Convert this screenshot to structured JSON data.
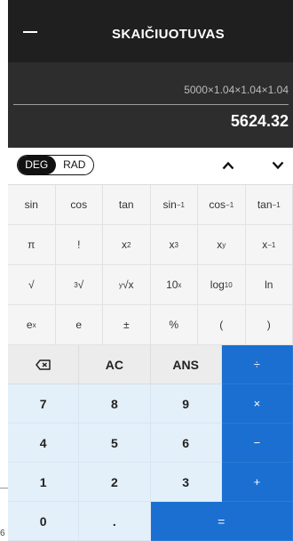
{
  "header": {
    "title": "SKAIČIUOTUVAS"
  },
  "display": {
    "expression": "5000×1.04×1.04×1.04",
    "result": "5624.32"
  },
  "mode": {
    "deg_label": "DEG",
    "rad_label": "RAD",
    "active": "DEG"
  },
  "scientific_keys": [
    [
      {
        "text": "sin"
      },
      {
        "text": "cos"
      },
      {
        "text": "tan"
      },
      {
        "text": "sin",
        "sup": "−1"
      },
      {
        "text": "cos",
        "sup": "−1"
      },
      {
        "text": "tan",
        "sup": "−1"
      }
    ],
    [
      {
        "text": "π"
      },
      {
        "text": "!"
      },
      {
        "text": "x",
        "sup": "2"
      },
      {
        "text": "x",
        "sup": "3"
      },
      {
        "text": "x",
        "sup": "y"
      },
      {
        "text": "x",
        "sup": "−1"
      }
    ],
    [
      {
        "text": "√"
      },
      {
        "pre": "3",
        "text": "√"
      },
      {
        "pre": "y",
        "text": "√x"
      },
      {
        "text": "10",
        "sup": "x"
      },
      {
        "text": "log",
        "sub": "10"
      },
      {
        "text": "ln"
      }
    ],
    [
      {
        "text": "e",
        "sup": "x"
      },
      {
        "text": "e"
      },
      {
        "text": "±"
      },
      {
        "text": "%"
      },
      {
        "text": "("
      },
      {
        "text": ")"
      }
    ]
  ],
  "main_keys": {
    "backspace_icon": "backspace-icon",
    "ac": "AC",
    "ans": "ANS",
    "divide": "÷",
    "n7": "7",
    "n8": "8",
    "n9": "9",
    "multiply": "×",
    "n4": "4",
    "n5": "5",
    "n6": "6",
    "minus": "−",
    "n1": "1",
    "n2": "2",
    "n3": "3",
    "plus": "+",
    "n0": "0",
    "dot": ".",
    "equals": "="
  },
  "background_fragment": {
    "text": "6"
  },
  "colors": {
    "header_bg": "#1f1f1f",
    "display_bg": "#2d2d2d",
    "accent_blue": "#1a6fd1",
    "number_key_bg": "#e3f0fa"
  }
}
